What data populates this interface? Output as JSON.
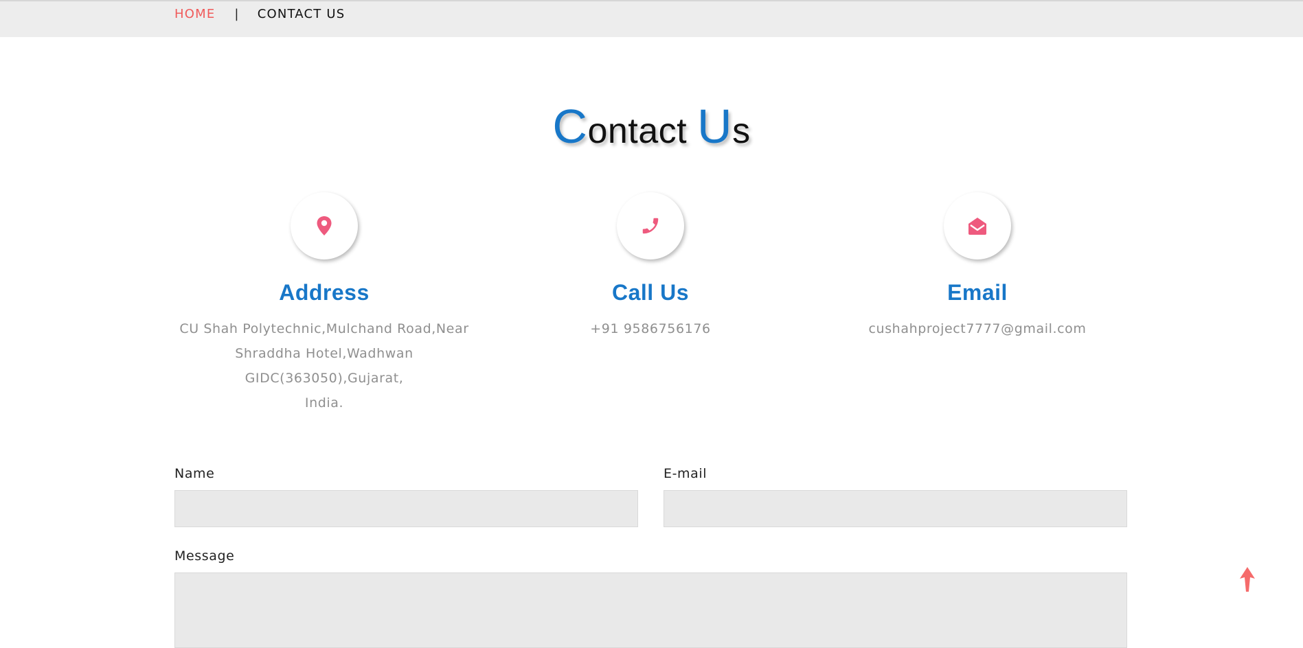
{
  "breadcrumb": {
    "home": "HOME",
    "separator": "|",
    "current": "CONTACT US"
  },
  "title": {
    "first_letter": "C",
    "first_rest": "ontact ",
    "second_letter": "U",
    "second_rest": "s"
  },
  "cards": {
    "address": {
      "icon": "map-pin-icon",
      "heading": "Address",
      "lines": [
        "CU Shah Polytechnic,Mulchand Road,Near",
        "Shraddha Hotel,Wadhwan",
        "GIDC(363050),Gujarat,",
        "India."
      ]
    },
    "call": {
      "icon": "phone-icon",
      "heading": "Call Us",
      "value": "+91 9586756176"
    },
    "email": {
      "icon": "envelope-open-icon",
      "heading": "Email",
      "value": "cushahproject7777@gmail.com"
    }
  },
  "form": {
    "name_label": "Name",
    "name_value": "",
    "email_label": "E-mail",
    "email_value": "",
    "message_label": "Message",
    "message_value": ""
  },
  "scroll_top": {
    "icon": "arrow-up-icon"
  },
  "colors": {
    "accent_blue": "#1877c8",
    "accent_red": "#f05a5a",
    "icon_pink": "#ee5a7e",
    "field_bg": "#e9e9e9",
    "topbar_bg": "#ededed"
  }
}
